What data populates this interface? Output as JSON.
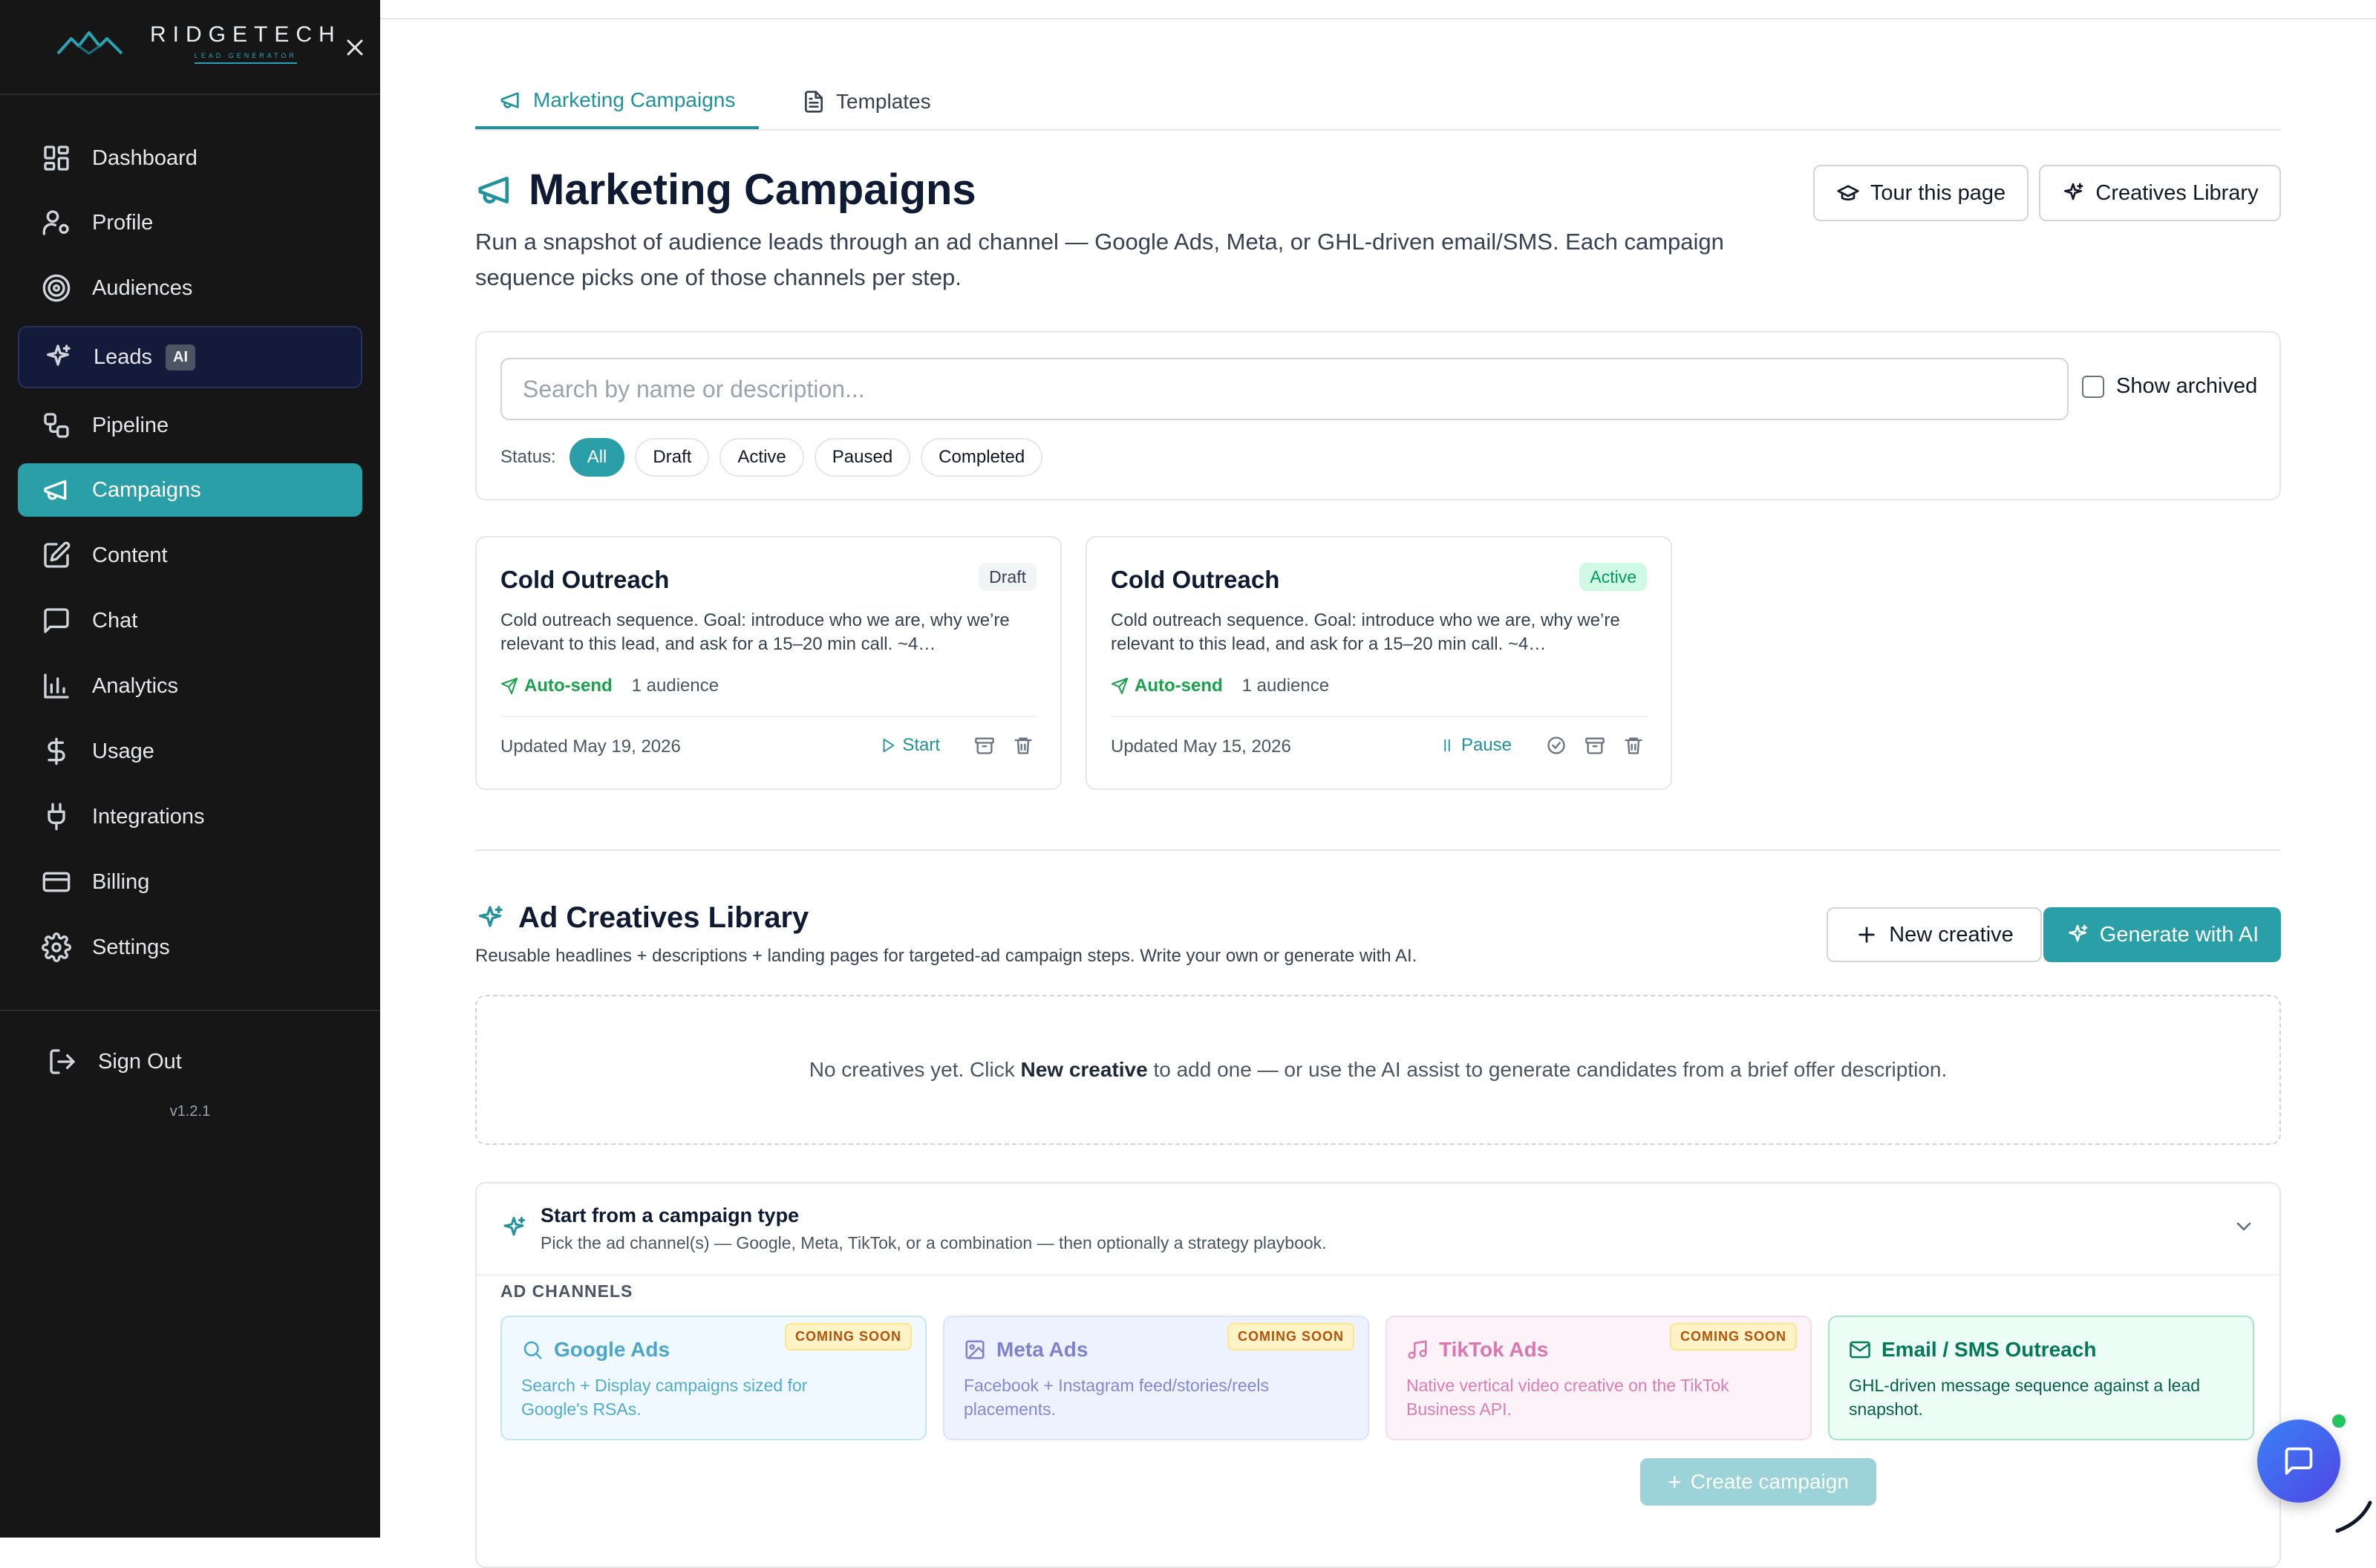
{
  "brand": {
    "name": "RIDGETECH",
    "sub": "LEAD GENERATOR"
  },
  "sidebar": {
    "items": [
      {
        "label": "Dashboard",
        "icon": "grid-icon"
      },
      {
        "label": "Profile",
        "icon": "user-gear-icon"
      },
      {
        "label": "Audiences",
        "icon": "target-icon"
      },
      {
        "label": "Leads",
        "icon": "sparkles-icon",
        "badge": "AI"
      },
      {
        "label": "Pipeline",
        "icon": "workflow-icon"
      },
      {
        "label": "Campaigns",
        "icon": "megaphone-icon",
        "active": true
      },
      {
        "label": "Content",
        "icon": "edit-icon"
      },
      {
        "label": "Chat",
        "icon": "message-icon"
      },
      {
        "label": "Analytics",
        "icon": "bar-chart-icon"
      },
      {
        "label": "Usage",
        "icon": "dollar-icon"
      },
      {
        "label": "Integrations",
        "icon": "plug-icon"
      },
      {
        "label": "Billing",
        "icon": "credit-card-icon"
      },
      {
        "label": "Settings",
        "icon": "gear-icon"
      }
    ],
    "signout": "Sign Out",
    "version": "v1.2.1"
  },
  "tabs": {
    "marketing": "Marketing Campaigns",
    "templates": "Templates"
  },
  "page": {
    "title": "Marketing Campaigns",
    "description": "Run a snapshot of audience leads through an ad channel — Google Ads, Meta, or GHL-driven email/SMS. Each campaign sequence picks one of those channels per step.",
    "tour_label": "Tour this page",
    "creatives_label": "Creatives Library"
  },
  "filters": {
    "search_placeholder": "Search by name or description...",
    "show_archived": "Show archived",
    "status_label": "Status:",
    "chips": [
      "All",
      "Draft",
      "Active",
      "Paused",
      "Completed"
    ],
    "active_chip": "All"
  },
  "campaigns": [
    {
      "title": "Cold Outreach",
      "status": "Draft",
      "description": "Cold outreach sequence. Goal: introduce who we are, why we’re relevant to this lead, and ask for a 15–20 min call. ~4…",
      "send_mode": "Auto-send",
      "audience": "1 audience",
      "updated": "Updated May 19, 2026",
      "primary_action": "Start"
    },
    {
      "title": "Cold Outreach",
      "status": "Active",
      "description": "Cold outreach sequence. Goal: introduce who we are, why we’re relevant to this lead, and ask for a 15–20 min call. ~4…",
      "send_mode": "Auto-send",
      "audience": "1 audience",
      "updated": "Updated May 15, 2026",
      "primary_action": "Pause"
    }
  ],
  "creatives": {
    "title": "Ad Creatives Library",
    "description": "Reusable headlines + descriptions + landing pages for targeted-ad campaign steps. Write your own or generate with AI.",
    "new_label": "New creative",
    "generate_label": "Generate with AI",
    "empty_pre": "No creatives yet. Click ",
    "empty_bold": "New creative",
    "empty_post": " to add one — or use the AI assist to generate candidates from a brief offer description."
  },
  "campaign_type": {
    "title": "Start from a campaign type",
    "subtitle": "Pick the ad channel(s) — Google, Meta, TikTok, or a combination — then optionally a strategy playbook.",
    "channels_label": "AD CHANNELS",
    "channels": [
      {
        "name": "Google Ads",
        "desc": "Search + Display campaigns sized for Google's RSAs.",
        "badge": "COMING SOON",
        "icon": "search-icon"
      },
      {
        "name": "Meta Ads",
        "desc": "Facebook + Instagram feed/stories/reels placements.",
        "badge": "COMING SOON",
        "icon": "image-icon"
      },
      {
        "name": "TikTok Ads",
        "desc": "Native vertical video creative on the TikTok Business API.",
        "badge": "COMING SOON",
        "icon": "music-icon"
      },
      {
        "name": "Email / SMS Outreach",
        "desc": "GHL-driven message sequence against a lead snapshot.",
        "icon": "mail-icon"
      }
    ],
    "create_label": "Create campaign"
  },
  "colors": {
    "accent": "#2a9fa8",
    "sidebar_bg": "#161616",
    "leads_bg": "#141a3a"
  }
}
